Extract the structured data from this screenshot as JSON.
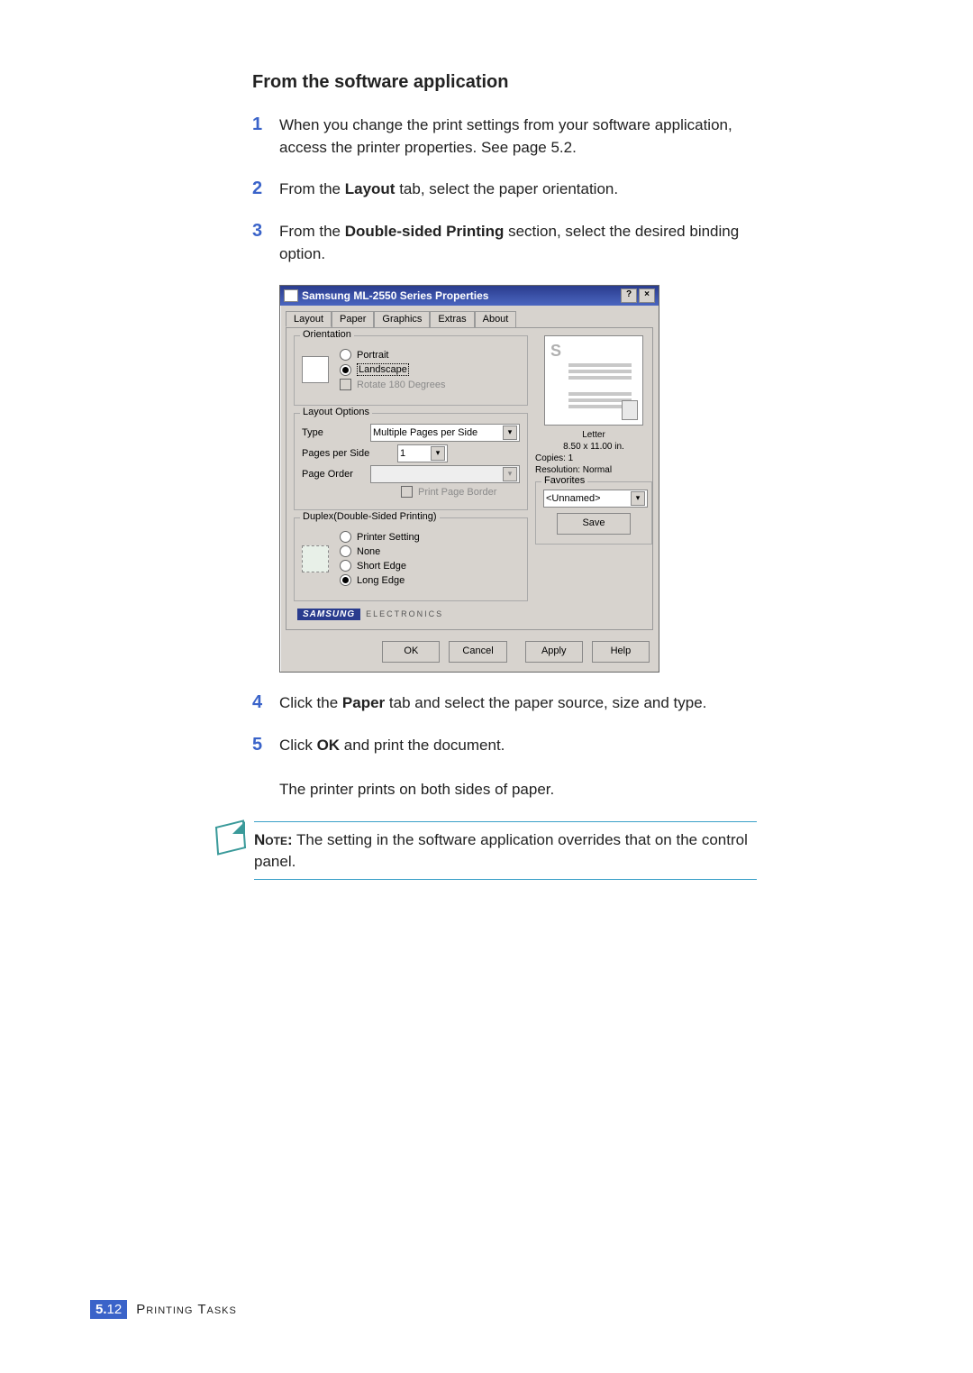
{
  "heading": "From the software application",
  "steps": {
    "s1_a": "When you change the print settings from your software application, access the printer properties. See ",
    "s1_b": "page 5.2",
    "s1_c": ".",
    "s2_a": "From the ",
    "s2_b": "Layout",
    "s2_c": " tab, select the paper orientation.",
    "s3_a": "From the ",
    "s3_b": "Double-sided Printing",
    "s3_c": " section, select the desired binding option.",
    "s4_a": "Click the ",
    "s4_b": "Paper",
    "s4_c": " tab and select the paper source, size and type.",
    "s5_a": "Click ",
    "s5_b": "OK",
    "s5_c": " and print the document.",
    "s5_extra": "The printer prints on both sides of paper."
  },
  "note": {
    "label": "Note:",
    "text": " The setting in the software application overrides that on the control panel."
  },
  "footer": {
    "chapter_num": "5.",
    "page_num": "12",
    "chapter_title": "Printing Tasks"
  },
  "dialog": {
    "title": "Samsung ML-2550 Series Properties",
    "help_btn": "?",
    "close_btn": "×",
    "tabs": [
      "Layout",
      "Paper",
      "Graphics",
      "Extras",
      "About"
    ],
    "orientation": {
      "legend": "Orientation",
      "portrait": "Portrait",
      "landscape": "Landscape",
      "rotate": "Rotate 180 Degrees"
    },
    "layout_options": {
      "legend": "Layout Options",
      "type_label": "Type",
      "type_value": "Multiple Pages per Side",
      "pps_label": "Pages per Side",
      "pps_value": "1",
      "order_label": "Page Order",
      "border_label": "Print Page Border"
    },
    "duplex": {
      "legend": "Duplex(Double-Sided Printing)",
      "printer_setting": "Printer Setting",
      "none": "None",
      "short": "Short Edge",
      "long": "Long Edge"
    },
    "preview": {
      "paper": "Letter",
      "size": "8.50 x 11.00 in.",
      "copies": "Copies: 1",
      "resolution": "Resolution: Normal"
    },
    "favorites": {
      "legend": "Favorites",
      "value": "<Unnamed>",
      "save": "Save"
    },
    "brand": {
      "logo": "SAMSUNG",
      "sub": "ELECTRONICS"
    },
    "buttons": {
      "ok": "OK",
      "cancel": "Cancel",
      "apply": "Apply",
      "help": "Help"
    }
  }
}
